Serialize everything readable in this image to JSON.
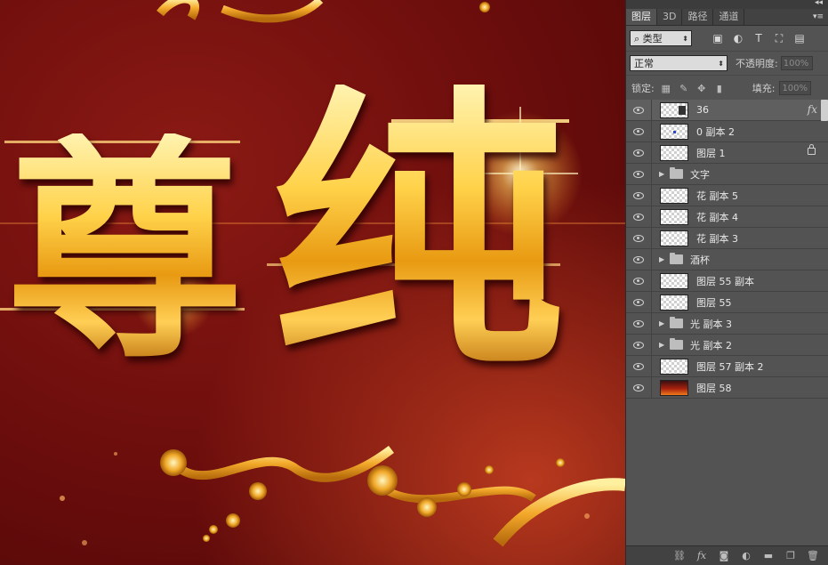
{
  "canvas": {
    "glyph_1": "尊",
    "glyph_2": "纯",
    "colors": {
      "bg_dark": "#5a0a0a",
      "bg_red": "#b8391e",
      "gold": "#ffd24a"
    }
  },
  "panel": {
    "tabs": [
      {
        "label": "图层",
        "active": true
      },
      {
        "label": "3D",
        "active": false
      },
      {
        "label": "路径",
        "active": false
      },
      {
        "label": "通道",
        "active": false
      }
    ],
    "filter": {
      "label": "类型",
      "icons": [
        "image-filter-icon",
        "adjustment-filter-icon",
        "type-filter-icon",
        "shape-filter-icon",
        "smart-object-filter-icon"
      ]
    },
    "blend": {
      "mode": "正常",
      "opacity_label": "不透明度:",
      "opacity_value": "100%"
    },
    "lock": {
      "label": "锁定:",
      "fill_label": "填充:",
      "fill_value": "100%"
    },
    "layers": [
      {
        "name": "36",
        "type": "layer",
        "thumb": "text",
        "fx": "fx",
        "selected": true
      },
      {
        "name": "0 副本 2",
        "type": "layer",
        "thumb": "blue"
      },
      {
        "name": "图层 1",
        "type": "layer",
        "thumb": "checker",
        "locked": true
      },
      {
        "name": "文字",
        "type": "group"
      },
      {
        "name": "花 副本 5",
        "type": "layer",
        "thumb": "checker"
      },
      {
        "name": "花 副本 4",
        "type": "layer",
        "thumb": "checker"
      },
      {
        "name": "花 副本 3",
        "type": "layer",
        "thumb": "checker"
      },
      {
        "name": "酒杯",
        "type": "group"
      },
      {
        "name": "图层 55 副本",
        "type": "layer",
        "thumb": "checker"
      },
      {
        "name": "图层 55",
        "type": "layer",
        "thumb": "checker"
      },
      {
        "name": "光 副本 3",
        "type": "group"
      },
      {
        "name": "光 副本 2",
        "type": "group"
      },
      {
        "name": "图层 57 副本 2",
        "type": "layer",
        "thumb": "checker"
      },
      {
        "name": "图层 58",
        "type": "layer",
        "thumb": "bg"
      }
    ],
    "bottom_icons": [
      "link-layers-icon",
      "fx-icon",
      "mask-icon",
      "adjustment-icon",
      "new-group-icon",
      "new-layer-icon",
      "trash-icon"
    ]
  }
}
